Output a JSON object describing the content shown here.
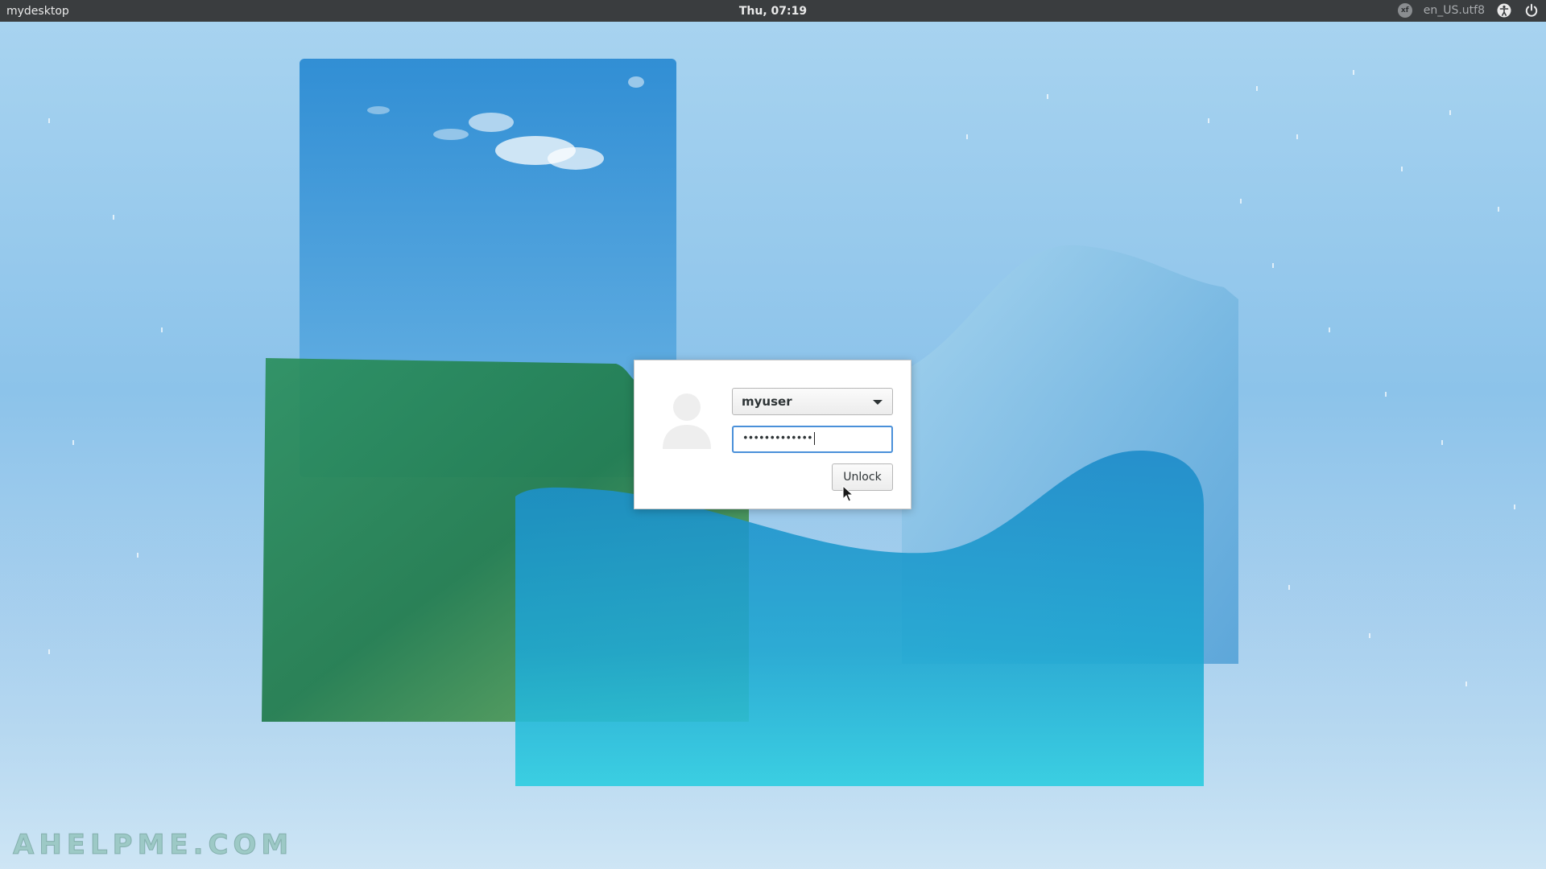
{
  "topbar": {
    "hostname": "mydesktop",
    "clock": "Thu, 07:19",
    "tray": {
      "xf_badge": "xf",
      "locale": "en_US.utf8",
      "accessibility_icon": "accessibility-icon",
      "power_icon": "power-icon"
    }
  },
  "lock_dialog": {
    "avatar_icon": "user-avatar-icon",
    "username": "myuser",
    "password_masked": "•••••••••••••",
    "unlock_label": "Unlock"
  },
  "watermark": "AHELPME.COM",
  "colors": {
    "topbar_bg": "#3a3d3f",
    "focus_ring": "#4a90d9",
    "dialog_bg": "#ffffff"
  }
}
